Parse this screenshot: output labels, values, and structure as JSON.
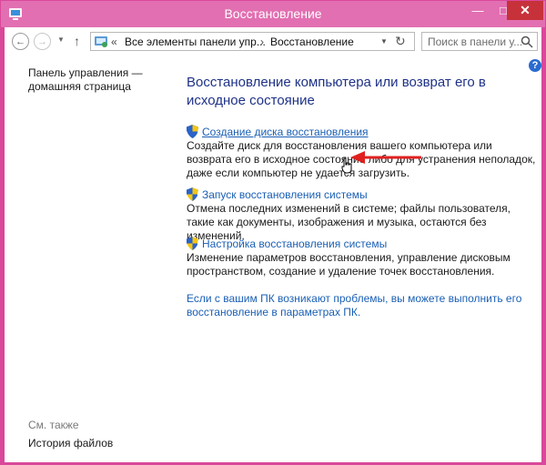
{
  "window": {
    "title": "Восстановление",
    "controls": {
      "minimize": "—",
      "maximize": "□",
      "close": "✕"
    }
  },
  "nav": {
    "back_glyph": "←",
    "forward_glyph": "→",
    "recent_glyph": "▼",
    "up_glyph": "↑",
    "address": {
      "icon": "control-panel-icon",
      "chevron": "«",
      "segment1": "Все элементы панели упр...",
      "separator": "›",
      "segment2": "Восстановление",
      "dropdown_glyph": "▼",
      "refresh_glyph": "↻"
    },
    "search_placeholder": "Поиск в панели у..."
  },
  "sidebar": {
    "home_link": "Панель управления — домашняя страница",
    "see_also": "См. также",
    "history_link": "История файлов"
  },
  "main": {
    "title": "Восстановление компьютера или возврат его в исходное состояние",
    "sections": [
      {
        "link": "Создание диска восстановления",
        "desc": "Создайте диск для восстановления вашего компьютера или возврата его в исходное состояние либо для устранения неполадок, даже если компьютер не удается загрузить."
      },
      {
        "link": "Запуск восстановления системы",
        "desc": "Отмена последних изменений в системе; файлы пользователя, такие как документы, изображения и музыка, остаются без изменений."
      },
      {
        "link": "Настройка восстановления системы",
        "desc": "Изменение параметров восстановления, управление дисковым пространством, создание и удаление точек восстановления."
      }
    ],
    "recovery_link": "Если с вашим ПК возникают проблемы, вы можете выполнить его восстановление в параметрах ПК."
  },
  "help": "?",
  "colors": {
    "title_bar": "#e26fb1",
    "frame": "#d9489a",
    "close_button": "#c7313a",
    "heading": "#1e3287",
    "link": "#1a5fb4",
    "annotation_arrow": "#e02020"
  }
}
